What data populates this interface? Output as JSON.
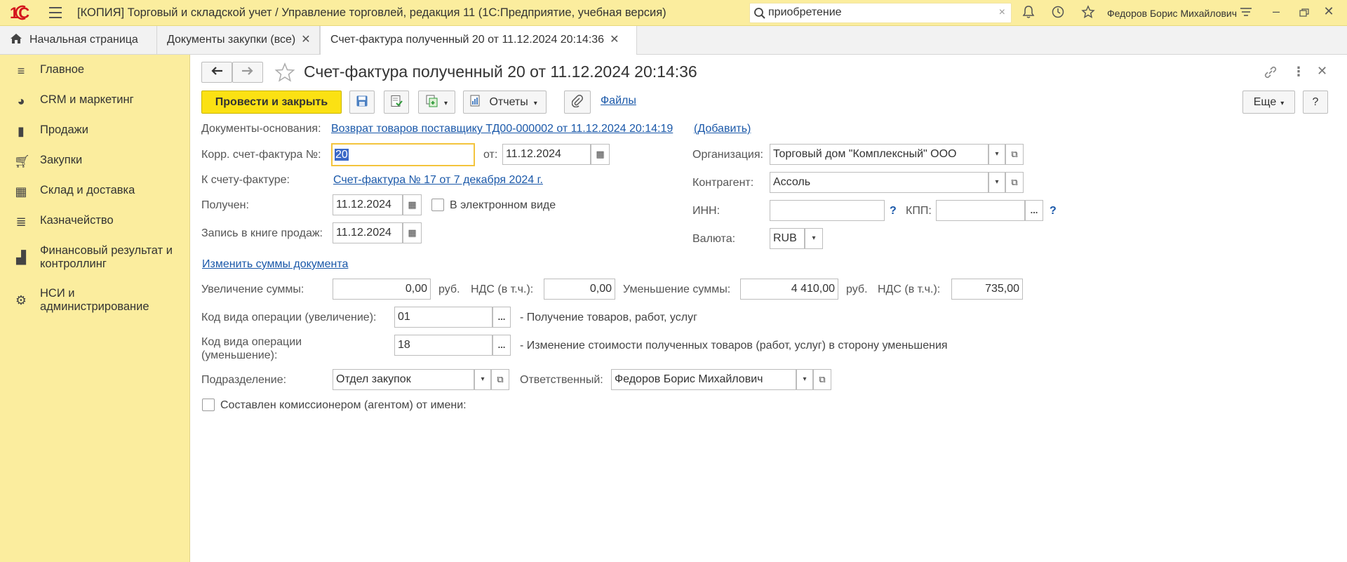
{
  "titlebar": {
    "logo": "1С",
    "title": "[КОПИЯ] Торговый и складской учет / Управление торговлей, редакция 11  (1С:Предприятие, учебная версия)",
    "search_value": "приобретение",
    "user": "Федоров Борис Михайлович",
    "clear": "×"
  },
  "tabs": {
    "home": "Начальная страница",
    "docs": "Документы закупки (все)",
    "current": "Счет-фактура полученный 20 от 11.12.2024 20:14:36",
    "close": "✕"
  },
  "sidebar": {
    "items": [
      {
        "label": "Главное",
        "icon": "menu-icon"
      },
      {
        "label": "CRM и маркетинг",
        "icon": "pie-chart-icon"
      },
      {
        "label": "Продажи",
        "icon": "shopping-bag-icon"
      },
      {
        "label": "Закупки",
        "icon": "cart-icon"
      },
      {
        "label": "Склад и доставка",
        "icon": "warehouse-icon"
      },
      {
        "label": "Казначейство",
        "icon": "coins-icon"
      },
      {
        "label": "Финансовый результат и контроллинг",
        "icon": "bar-chart-icon"
      },
      {
        "label": "НСИ и администрирование",
        "icon": "gear-icon"
      }
    ]
  },
  "form": {
    "title": "Счет-фактура полученный 20 от 11.12.2024 20:14:36",
    "post_close": "Провести и закрыть",
    "reports": "Отчеты",
    "files": "Файлы",
    "more": "Еще",
    "help": "?",
    "basis_label": "Документы-основания:",
    "basis_link": "Возврат товаров поставщику ТД00-000002 от 11.12.2024 20:14:19",
    "basis_add": "(Добавить)",
    "corr_label": "Корр. счет-фактура №:",
    "corr_value": "20",
    "from_label": "от:",
    "from_value": "11.12.2024",
    "to_invoice_label": "К счету-фактуре:",
    "to_invoice_link": "Счет-фактура № 17 от 7 декабря 2024 г.",
    "received_label": "Получен:",
    "received_value": "11.12.2024",
    "electronic_label": "В электронном виде",
    "sales_book_label": "Запись в книге продаж:",
    "sales_book_value": "11.12.2024",
    "org_label": "Организация:",
    "org_value": "Торговый дом \"Комплексный\" ООО",
    "contractor_label": "Контрагент:",
    "contractor_value": "Ассоль",
    "inn_label": "ИНН:",
    "inn_value": "",
    "kpp_label": "КПП:",
    "kpp_value": "",
    "currency_label": "Валюта:",
    "currency_value": "RUB",
    "change_sums_link": "Изменить суммы документа",
    "increase_label": "Увеличение суммы:",
    "increase_value": "0,00",
    "rub1": "руб.",
    "vat1_label": "НДС (в т.ч.):",
    "vat1_value": "0,00",
    "decrease_label": "Уменьшение суммы:",
    "decrease_value": "4 410,00",
    "rub2": "руб.",
    "vat2_label": "НДС (в т.ч.):",
    "vat2_value": "735,00",
    "op_inc_label": "Код вида операции (увеличение):",
    "op_inc_value": "01",
    "op_inc_desc": "- Получение товаров, работ, услуг",
    "op_dec_label": "Код вида операции (уменьшение):",
    "op_dec_value": "18",
    "op_dec_desc": "- Изменение стоимости полученных товаров (работ, услуг) в сторону уменьшения",
    "dept_label": "Подразделение:",
    "dept_value": "Отдел закупок",
    "resp_label": "Ответственный:",
    "resp_value": "Федоров Борис Михайлович",
    "agent_label": "Составлен комиссионером (агентом) от имени:",
    "ellipsis": "...",
    "q": "?"
  }
}
